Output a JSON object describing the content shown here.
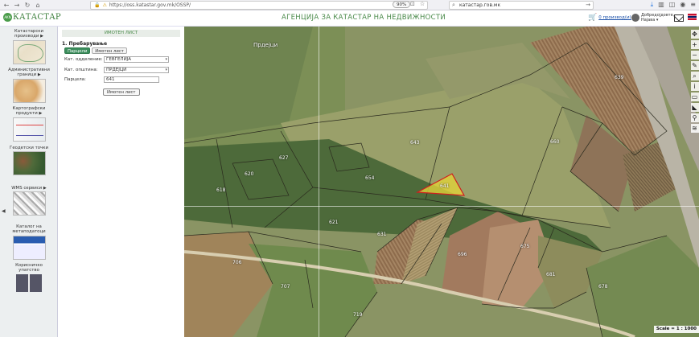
{
  "browser": {
    "url": "https://oss.katastar.gov.mk/OSSP/",
    "zoom": "90%",
    "search_value": "катастар.гов.мк",
    "icons": [
      "back-icon",
      "forward-icon",
      "reload-icon",
      "home-icon",
      "lock-icon",
      "warning-icon",
      "bookmark-icon",
      "pocket-icon",
      "search-icon",
      "go-icon",
      "download-icon",
      "library-icon",
      "sidebar-icon",
      "account-icon",
      "menu-icon"
    ]
  },
  "header": {
    "logo_text": "КАТАСТАР",
    "logo_badge": "AKN",
    "agency": "АГЕНЦИЈА ЗА КАТАСТАР НА НЕДВИЖНОСТИ",
    "cart_label": "0 производ(и)",
    "user_greeting": "Добредојдовте,",
    "user_name": "Најава"
  },
  "sidebar": {
    "items": [
      {
        "label": "Катастарски производи",
        "arrow": "▶"
      },
      {
        "label": "Административни граници",
        "arrow": "▶"
      },
      {
        "label": "Картографски продукти",
        "arrow": "▶"
      },
      {
        "label": "Геодетски точки",
        "arrow": ""
      },
      {
        "label": "WMS сервиси",
        "arrow": "▶"
      },
      {
        "label": "Каталог на метаподатоци",
        "arrow": ""
      },
      {
        "label": "Корисничко упатство",
        "arrow": ""
      }
    ],
    "collapse_icon": "◀"
  },
  "panel": {
    "title": "ИМОТЕН ЛИСТ",
    "section": "1. Пребарување",
    "tabs": [
      {
        "label": "Парцели",
        "active": true
      },
      {
        "label": "Имотен лист",
        "active": false
      }
    ],
    "fields": {
      "dept_label": "Кат. одделение:",
      "dept_value": "ГЕВГЕЛИЈА",
      "muni_label": "Кат. општина:",
      "muni_value": "ПРДЕЈЦИ",
      "parcel_label": "Парцела:",
      "parcel_value": "641"
    },
    "submit_label": "Имотен лист"
  },
  "map": {
    "place_label": "Прдејци",
    "parcel_labels": [
      "643",
      "641",
      "654",
      "620",
      "618",
      "627",
      "621",
      "631",
      "696",
      "660",
      "675",
      "681",
      "707",
      "678",
      "706",
      "719",
      "639"
    ],
    "scale": "Scale = 1 : 1000",
    "tools": [
      "pan-icon",
      "zoom-in-icon",
      "zoom-out-icon",
      "measure-icon",
      "search-icon",
      "info-icon",
      "layers-icon",
      "print-icon",
      "location-icon",
      "stack-icon"
    ]
  }
}
